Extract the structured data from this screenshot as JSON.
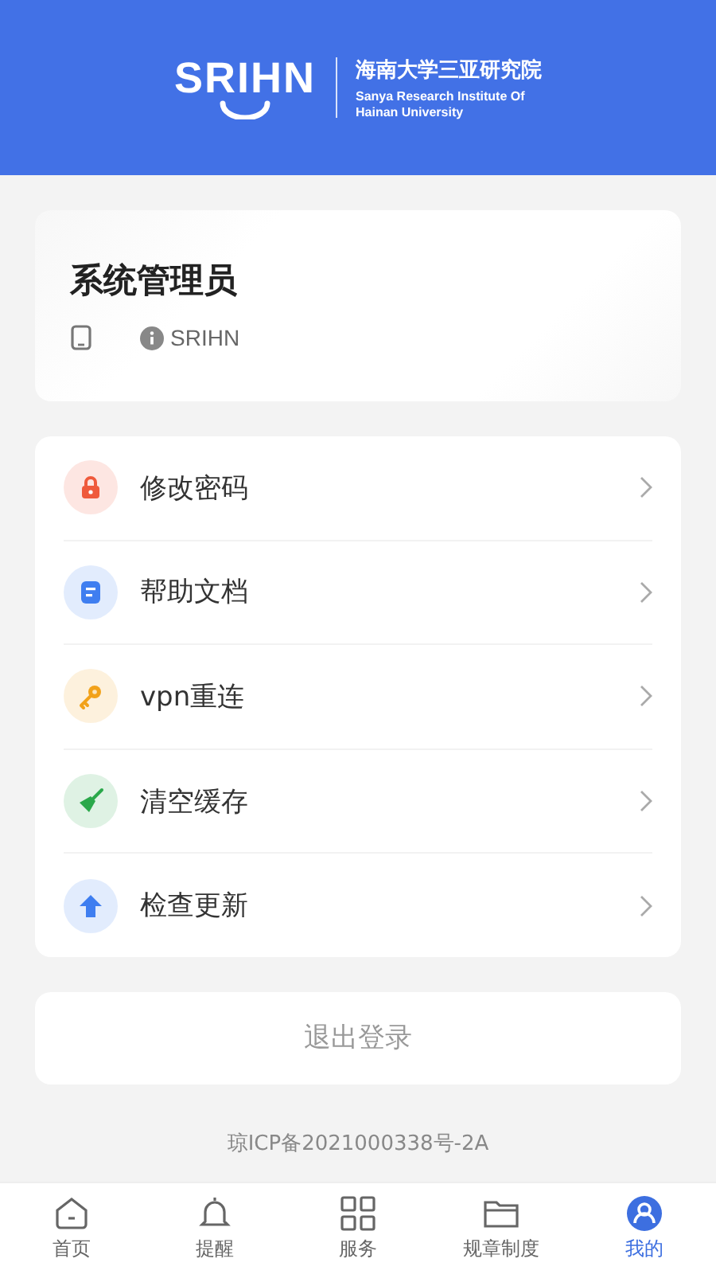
{
  "header": {
    "logo_text": "SRIHN",
    "name_cn": "海南大学三亚研究院",
    "name_en_line1": "Sanya Research Institute Of",
    "name_en_line2": "Hainan University"
  },
  "profile": {
    "name": "系统管理员",
    "org": "SRIHN"
  },
  "menu": [
    {
      "kind": "lock",
      "label": "修改密码",
      "color": "#ef5a3c"
    },
    {
      "kind": "doc",
      "label": "帮助文档",
      "color": "#3f7ef0"
    },
    {
      "kind": "key",
      "label": "vpn重连",
      "color": "#f2a21a"
    },
    {
      "kind": "broom",
      "label": "清空缓存",
      "color": "#2aa84a"
    },
    {
      "kind": "upload",
      "label": "检查更新",
      "color": "#3f7ef0"
    }
  ],
  "logout": "退出登录",
  "icp": "琼ICP备2021000338号-2A",
  "tabs": [
    {
      "kind": "home",
      "label": "首页",
      "selected": false
    },
    {
      "kind": "bell",
      "label": "提醒",
      "selected": false
    },
    {
      "kind": "grid",
      "label": "服务",
      "selected": false
    },
    {
      "kind": "folder",
      "label": "规章制度",
      "selected": false
    },
    {
      "kind": "user",
      "label": "我的",
      "selected": true
    }
  ]
}
